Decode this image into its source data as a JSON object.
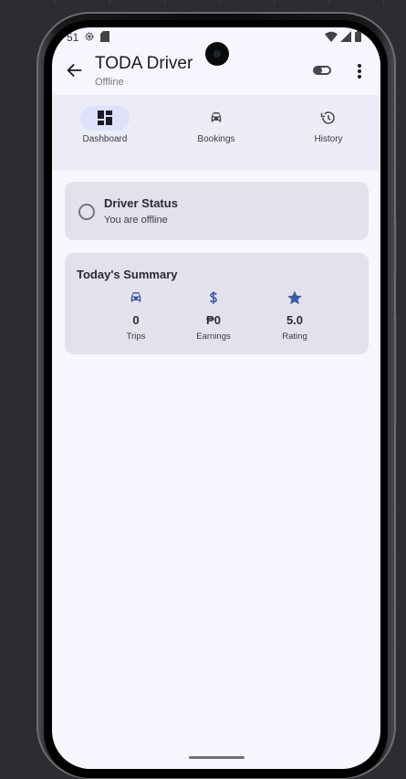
{
  "status_bar": {
    "time": "51"
  },
  "app_bar": {
    "title": "TODA Driver",
    "subtitle": "Offline"
  },
  "nav": [
    {
      "label": "Dashboard",
      "icon": "dashboard-icon",
      "active": true
    },
    {
      "label": "Bookings",
      "icon": "car-icon",
      "active": false
    },
    {
      "label": "History",
      "icon": "history-icon",
      "active": false
    }
  ],
  "driver_status": {
    "title": "Driver Status",
    "subtitle": "You are offline"
  },
  "summary": {
    "title": "Today's Summary",
    "stats": [
      {
        "icon": "car-icon",
        "value": "0",
        "label": "Trips"
      },
      {
        "icon": "dollar-icon",
        "value": "₱0",
        "label": "Earnings"
      },
      {
        "icon": "star-icon",
        "value": "5.0",
        "label": "Rating"
      }
    ]
  },
  "colors": {
    "accent": "#3f5aa8",
    "screen_bg": "#f6f6ff",
    "nav_bg": "#ececf7",
    "card_bg": "#e3e1eb",
    "active_pill": "#dfe0fb"
  }
}
